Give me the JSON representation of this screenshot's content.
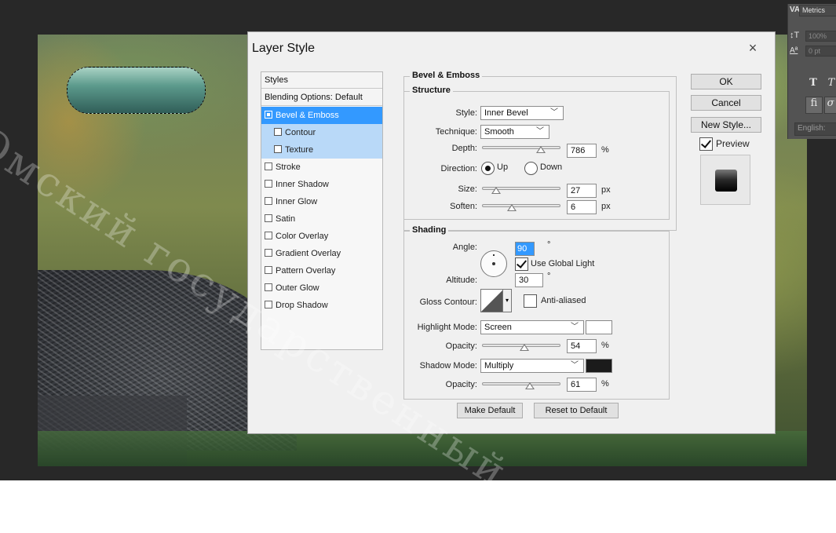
{
  "watermark": "Омский государственный ...",
  "char_panel": {
    "icon_tracking": "VA",
    "tab_label": "Metrics",
    "icon_vscale": "↕T",
    "vscale_value": "100%",
    "icon_baseline": "Aª",
    "baseline_value": "0 pt",
    "style_T": "T",
    "style_T_italic": "T",
    "ligature": "fi",
    "swash": "σ",
    "language": "English:"
  },
  "dialog": {
    "title": "Layer Style",
    "close": "×",
    "styles_list": {
      "header": "Styles",
      "blending": "Blending Options: Default",
      "items": [
        {
          "label": "Bevel & Emboss",
          "checked": true,
          "state": "selected"
        },
        {
          "label": "Contour",
          "checked": false,
          "state": "sub"
        },
        {
          "label": "Texture",
          "checked": false,
          "state": "sub"
        },
        {
          "label": "Stroke",
          "checked": false,
          "state": "normal"
        },
        {
          "label": "Inner Shadow",
          "checked": false,
          "state": "normal"
        },
        {
          "label": "Inner Glow",
          "checked": false,
          "state": "normal"
        },
        {
          "label": "Satin",
          "checked": false,
          "state": "normal"
        },
        {
          "label": "Color Overlay",
          "checked": false,
          "state": "normal"
        },
        {
          "label": "Gradient Overlay",
          "checked": false,
          "state": "normal"
        },
        {
          "label": "Pattern Overlay",
          "checked": false,
          "state": "normal"
        },
        {
          "label": "Outer Glow",
          "checked": false,
          "state": "normal"
        },
        {
          "label": "Drop Shadow",
          "checked": false,
          "state": "normal"
        }
      ]
    },
    "bevel": {
      "group_title": "Bevel & Emboss",
      "structure_title": "Structure",
      "style_label": "Style:",
      "style_value": "Inner Bevel",
      "technique_label": "Technique:",
      "technique_value": "Smooth",
      "depth_label": "Depth:",
      "depth_value": "786",
      "depth_unit": "%",
      "depth_level": 0.75,
      "direction_label": "Direction:",
      "up": "Up",
      "down": "Down",
      "size_label": "Size:",
      "size_value": "27",
      "size_unit": "px",
      "size_level": 0.18,
      "soften_label": "Soften:",
      "soften_value": "6",
      "soften_unit": "px",
      "soften_level": 0.38
    },
    "shading": {
      "title": "Shading",
      "angle_label": "Angle:",
      "angle_value": "90",
      "degree": "°",
      "global_light": "Use Global Light",
      "altitude_label": "Altitude:",
      "altitude_value": "30",
      "gloss_label": "Gloss Contour:",
      "anti_aliased": "Anti-aliased",
      "highlight_label": "Highlight Mode:",
      "highlight_value": "Screen",
      "highlight_color": "#ffffff",
      "opacity_label": "Opacity:",
      "highlight_opacity": "54",
      "highlight_opacity_level": 0.54,
      "shadow_label": "Shadow Mode:",
      "shadow_value": "Multiply",
      "shadow_color": "#1b1b1b",
      "shadow_opacity": "61",
      "shadow_opacity_level": 0.61,
      "pct": "%"
    },
    "buttons": {
      "ok": "OK",
      "cancel": "Cancel",
      "new_style": "New Style...",
      "preview": "Preview",
      "make_default": "Make Default",
      "reset_default": "Reset to Default"
    }
  }
}
